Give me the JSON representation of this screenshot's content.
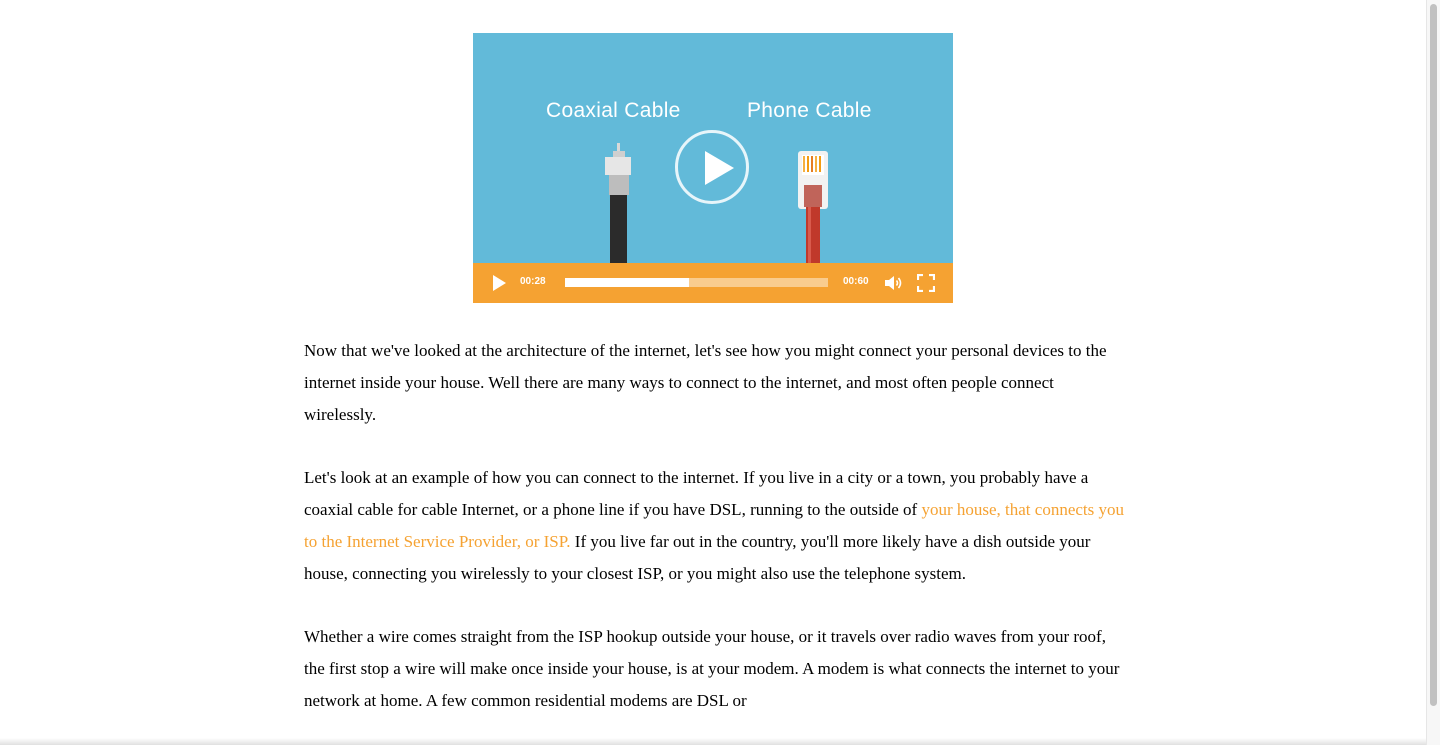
{
  "video": {
    "labels": {
      "coax": "Coaxial Cable",
      "phone": "Phone Cable"
    },
    "current_time": "00:28",
    "duration": "00:60",
    "progress": 0.47
  },
  "article": {
    "paragraphs": [
      {
        "text": "Now that we've looked at the architecture of the internet, let's see how you might connect your personal devices to the internet inside your house. Well there are many ways to connect to the internet, and most often people connect wirelessly."
      },
      {
        "before": "Let's look at an example of how you can connect to the internet. If you live in a city or a town, you probably have a coaxial cable for cable Internet, or a phone line if you have DSL, running to the outside of ",
        "highlight": "your house, that connects you to the Internet Service Provider, or ISP.",
        "after": " If you live far out in the country, you'll more likely have a dish outside your house, connecting you wirelessly to your closest ISP, or you might also use the telephone system."
      },
      {
        "text": "Whether a wire comes straight from the ISP hookup outside your house, or it travels over radio waves from your roof, the first stop a wire will make once inside your house, is at your modem. A modem is what connects the internet to your network at home. A few common residential modems are DSL or"
      }
    ]
  },
  "colors": {
    "video_bg": "#62bad9",
    "controls_bg": "#f5a232",
    "highlight": "#f5a232",
    "cable_red": "#c0392b",
    "cable_black": "#2b2b2b"
  }
}
